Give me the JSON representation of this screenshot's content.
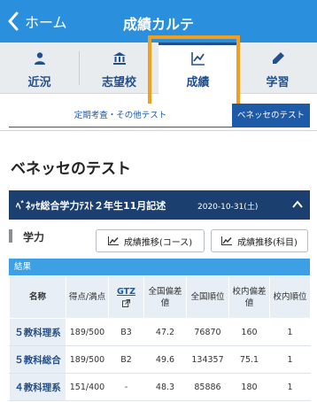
{
  "header": {
    "back_label": "ホーム",
    "title": "成績カルテ",
    "back_icon": "chevron-left-icon",
    "background_color": "#2a8fdc"
  },
  "tabs": [
    {
      "label": "近況",
      "icon": "person-icon",
      "active": false
    },
    {
      "label": "志望校",
      "icon": "building-icon",
      "active": false
    },
    {
      "label": "成績",
      "icon": "line-chart-icon",
      "active": true
    },
    {
      "label": "学習",
      "icon": "pencil-icon",
      "active": false
    }
  ],
  "subtabs": [
    {
      "label": "定期考査・その他テスト",
      "active": false
    },
    {
      "label": "ベネッセのテスト",
      "active": true
    }
  ],
  "section": {
    "title": "ベネッセのテスト"
  },
  "test": {
    "name": "ﾍﾞﾈｯｾ総合学力ﾃｽﾄ２年生11月記述",
    "date": "2020-10-31(土)",
    "chevron": "chevron-up-icon",
    "bar_color": "#1b3f6e"
  },
  "subject": {
    "label": "学力"
  },
  "buttons": {
    "trend_course": "成績推移(コース)",
    "trend_subject": "成績推移(科目)",
    "icon": "line-chart-icon"
  },
  "results": {
    "label": "結果",
    "columns": [
      "名称",
      "得点/満点",
      "GTZ",
      "全国偏差値",
      "全国順位",
      "校内偏差値",
      "校内順位"
    ],
    "rows": [
      [
        "５教科理系",
        "189/500",
        "B3",
        "47.2",
        "76870",
        "160",
        "1"
      ],
      [
        "５教科総合",
        "189/500",
        "B2",
        "49.6",
        "134357",
        "75.1",
        "1"
      ],
      [
        "４教科理系",
        "151/400",
        "-",
        "48.3",
        "85886",
        "180",
        "1"
      ]
    ]
  },
  "accent_colors": {
    "highlight_box": "#f0a020",
    "active_subtab": "#1d5aa8",
    "result_bar": "#3ea0e4"
  }
}
